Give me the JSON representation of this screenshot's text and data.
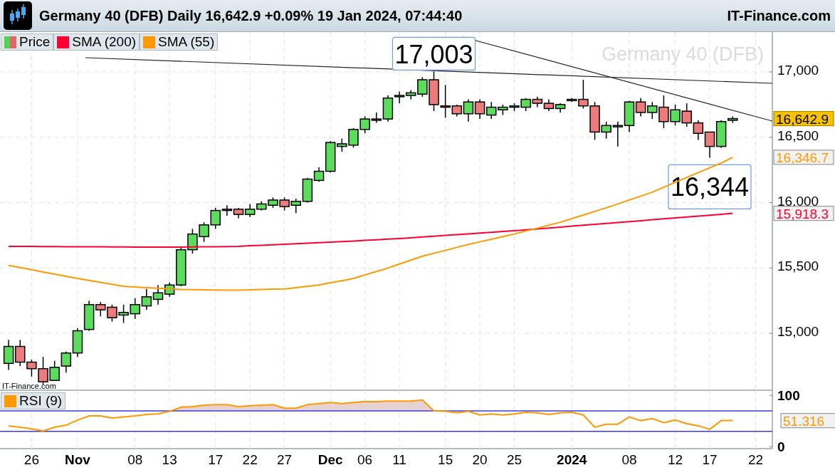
{
  "header": {
    "title": "Germany 40 (DFB) Daily 16,642.9 +0.09% 19 Jan 2024, 07:44:40",
    "brand": "IT-Finance.com"
  },
  "price_chart": {
    "price_legend": "Price",
    "title_label": "Germany 40 (DFB)",
    "source_label": "IT-Finance.com",
    "chart_data": {
      "type": "candlestick",
      "grid": true,
      "categories": [
        null,
        null,
        "26",
        null,
        null,
        null,
        "Nov",
        null,
        null,
        null,
        null,
        "08",
        null,
        null,
        "13",
        null,
        null,
        null,
        "17",
        null,
        null,
        "22",
        null,
        null,
        "27",
        null,
        null,
        null,
        "Dec",
        null,
        null,
        "06",
        null,
        null,
        "11",
        null,
        null,
        null,
        "15",
        null,
        null,
        "20",
        null,
        null,
        "25",
        null,
        null,
        null,
        null,
        "2024",
        null,
        null,
        null,
        null,
        "08",
        null,
        null,
        null,
        "12",
        null,
        null,
        "17",
        null,
        null,
        null,
        "22"
      ],
      "ylim": [
        14565,
        17305
      ],
      "yticks": [
        {
          "value": 15000,
          "label": "15,000"
        },
        {
          "value": 15500,
          "label": "15,500"
        },
        {
          "value": 16000,
          "label": "16,000"
        },
        {
          "value": 16500,
          "label": "16,500"
        },
        {
          "value": 17000,
          "label": "17,000"
        }
      ],
      "ohlc": [
        [
          14770,
          14950,
          14720,
          14900
        ],
        [
          14900,
          14950,
          14750,
          14780
        ],
        [
          14780,
          14800,
          14670,
          14730
        ],
        [
          14730,
          14820,
          14610,
          14630
        ],
        [
          14640,
          14790,
          14640,
          14740
        ],
        [
          14750,
          14860,
          14700,
          14850
        ],
        [
          14850,
          15040,
          14820,
          15020
        ],
        [
          15030,
          15250,
          15020,
          15220
        ],
        [
          15220,
          15240,
          15130,
          15180
        ],
        [
          15200,
          15220,
          15090,
          15120
        ],
        [
          15140,
          15220,
          15080,
          15160
        ],
        [
          15150,
          15270,
          15110,
          15220
        ],
        [
          15210,
          15340,
          15180,
          15280
        ],
        [
          15260,
          15370,
          15220,
          15310
        ],
        [
          15300,
          15390,
          15280,
          15370
        ],
        [
          15370,
          15660,
          15360,
          15640
        ],
        [
          15640,
          15800,
          15610,
          15760
        ],
        [
          15740,
          15850,
          15700,
          15830
        ],
        [
          15830,
          15960,
          15800,
          15940
        ],
        [
          15950,
          15980,
          15900,
          15940
        ],
        [
          15950,
          15960,
          15880,
          15910
        ],
        [
          15910,
          15990,
          15890,
          15950
        ],
        [
          15950,
          16010,
          15940,
          15990
        ],
        [
          15980,
          16040,
          15960,
          16020
        ],
        [
          16020,
          16040,
          15940,
          15970
        ],
        [
          15980,
          16030,
          15920,
          16010
        ],
        [
          16010,
          16190,
          16000,
          16180
        ],
        [
          16170,
          16270,
          16160,
          16240
        ],
        [
          16240,
          16470,
          16230,
          16460
        ],
        [
          16430,
          16490,
          16390,
          16450
        ],
        [
          16440,
          16570,
          16420,
          16560
        ],
        [
          16560,
          16660,
          16530,
          16640
        ],
        [
          16640,
          16690,
          16610,
          16630
        ],
        [
          16640,
          16820,
          16620,
          16800
        ],
        [
          16810,
          16850,
          16760,
          16820
        ],
        [
          16820,
          16860,
          16790,
          16840
        ],
        [
          16830,
          16960,
          16810,
          16940
        ],
        [
          16940,
          17003,
          16700,
          16750
        ],
        [
          16740,
          16900,
          16650,
          16730
        ],
        [
          16740,
          16750,
          16660,
          16680
        ],
        [
          16680,
          16790,
          16620,
          16770
        ],
        [
          16770,
          16790,
          16640,
          16680
        ],
        [
          16670,
          16770,
          16640,
          16730
        ],
        [
          16710,
          16750,
          16670,
          16730
        ],
        [
          16730,
          16760,
          16700,
          16740
        ],
        [
          16730,
          16800,
          16700,
          16790
        ],
        [
          16790,
          16810,
          16730,
          16760
        ],
        [
          16760,
          16790,
          16700,
          16720
        ],
        [
          16720,
          16760,
          16690,
          16750
        ],
        [
          16780,
          16800,
          16770,
          16790
        ],
        [
          16790,
          16940,
          16720,
          16740
        ],
        [
          16740,
          16770,
          16480,
          16540
        ],
        [
          16540,
          16620,
          16490,
          16590
        ],
        [
          16580,
          16620,
          16430,
          16590
        ],
        [
          16590,
          16780,
          16540,
          16770
        ],
        [
          16770,
          16800,
          16660,
          16690
        ],
        [
          16690,
          16770,
          16640,
          16740
        ],
        [
          16730,
          16820,
          16570,
          16620
        ],
        [
          16620,
          16750,
          16590,
          16710
        ],
        [
          16700,
          16760,
          16580,
          16610
        ],
        [
          16610,
          16630,
          16480,
          16530
        ],
        [
          16540,
          16540,
          16344,
          16430
        ],
        [
          16430,
          16630,
          16420,
          16620
        ],
        [
          16630,
          16660,
          16610,
          16642.9
        ],
        null,
        null
      ],
      "series": [
        {
          "name": "SMA (200)",
          "type": "line",
          "color": "#ff0033",
          "values": [
            15665,
            15665,
            15665,
            15664,
            15664,
            15663,
            15663,
            15662,
            15662,
            15661,
            15661,
            15660,
            15660,
            15660,
            15660,
            15660,
            15661,
            15662,
            15663,
            15664,
            15666,
            15670,
            15674,
            15678,
            15682,
            15686,
            15690,
            15694,
            15698,
            15702,
            15706,
            15711,
            15716,
            15721,
            15726,
            15731,
            15737,
            15743,
            15749,
            15755,
            15761,
            15767,
            15773,
            15779,
            15785,
            15792,
            15799,
            15806,
            15813,
            15820,
            15827,
            15834,
            15841,
            15848,
            15855,
            15862,
            15869,
            15876,
            15883,
            15890,
            15897,
            15904,
            15911,
            15918,
            null,
            null
          ]
        },
        {
          "name": "SMA (55)",
          "type": "line",
          "color": "#ff9900",
          "values": [
            15520,
            15503,
            15487,
            15470,
            15453,
            15437,
            15420,
            15405,
            15390,
            15375,
            15360,
            15355,
            15350,
            15345,
            15340,
            15335,
            15334,
            15333,
            15332,
            15331,
            15330,
            15333,
            15335,
            15338,
            15340,
            15350,
            15360,
            15370,
            15387,
            15403,
            15420,
            15447,
            15473,
            15500,
            15530,
            15560,
            15590,
            15613,
            15635,
            15658,
            15680,
            15700,
            15720,
            15740,
            15760,
            15783,
            15805,
            15828,
            15850,
            15878,
            15905,
            15933,
            15960,
            15990,
            16020,
            16050,
            16080,
            16118,
            16155,
            16193,
            16230,
            16267,
            16303,
            16347,
            null,
            null
          ]
        }
      ],
      "annotations": [
        {
          "text": "17,003",
          "y": 17003
        },
        {
          "text": "16,344",
          "y": 16344
        },
        "16,642.9",
        "15,918.3",
        "16,346.7"
      ]
    }
  },
  "rsi_panel": {
    "chart_data": {
      "type": "line",
      "grid": true,
      "ylim": [
        -3.5,
        110
      ],
      "yticks": [
        0,
        100
      ],
      "series": [
        {
          "name": "RSI (9)",
          "color": "#ff9900",
          "values": [
            41,
            38,
            35,
            31,
            38,
            42,
            52,
            60,
            60,
            56,
            58,
            60,
            63,
            64,
            69,
            77,
            78,
            81,
            82,
            82,
            78,
            80,
            81,
            82,
            75,
            75,
            82,
            84,
            86,
            84,
            86,
            88,
            88,
            89,
            89,
            89,
            91,
            70,
            69,
            66,
            69,
            62,
            64,
            62,
            64,
            67,
            66,
            63,
            66,
            67,
            62,
            38,
            44,
            44,
            58,
            51,
            55,
            47,
            52,
            45,
            41,
            34,
            51,
            51,
            null,
            null
          ]
        }
      ],
      "ref_lines": [
        {
          "axis": "y",
          "value": 70
        },
        {
          "axis": "y",
          "value": 30
        }
      ],
      "annotations": [
        "51.316"
      ]
    }
  }
}
